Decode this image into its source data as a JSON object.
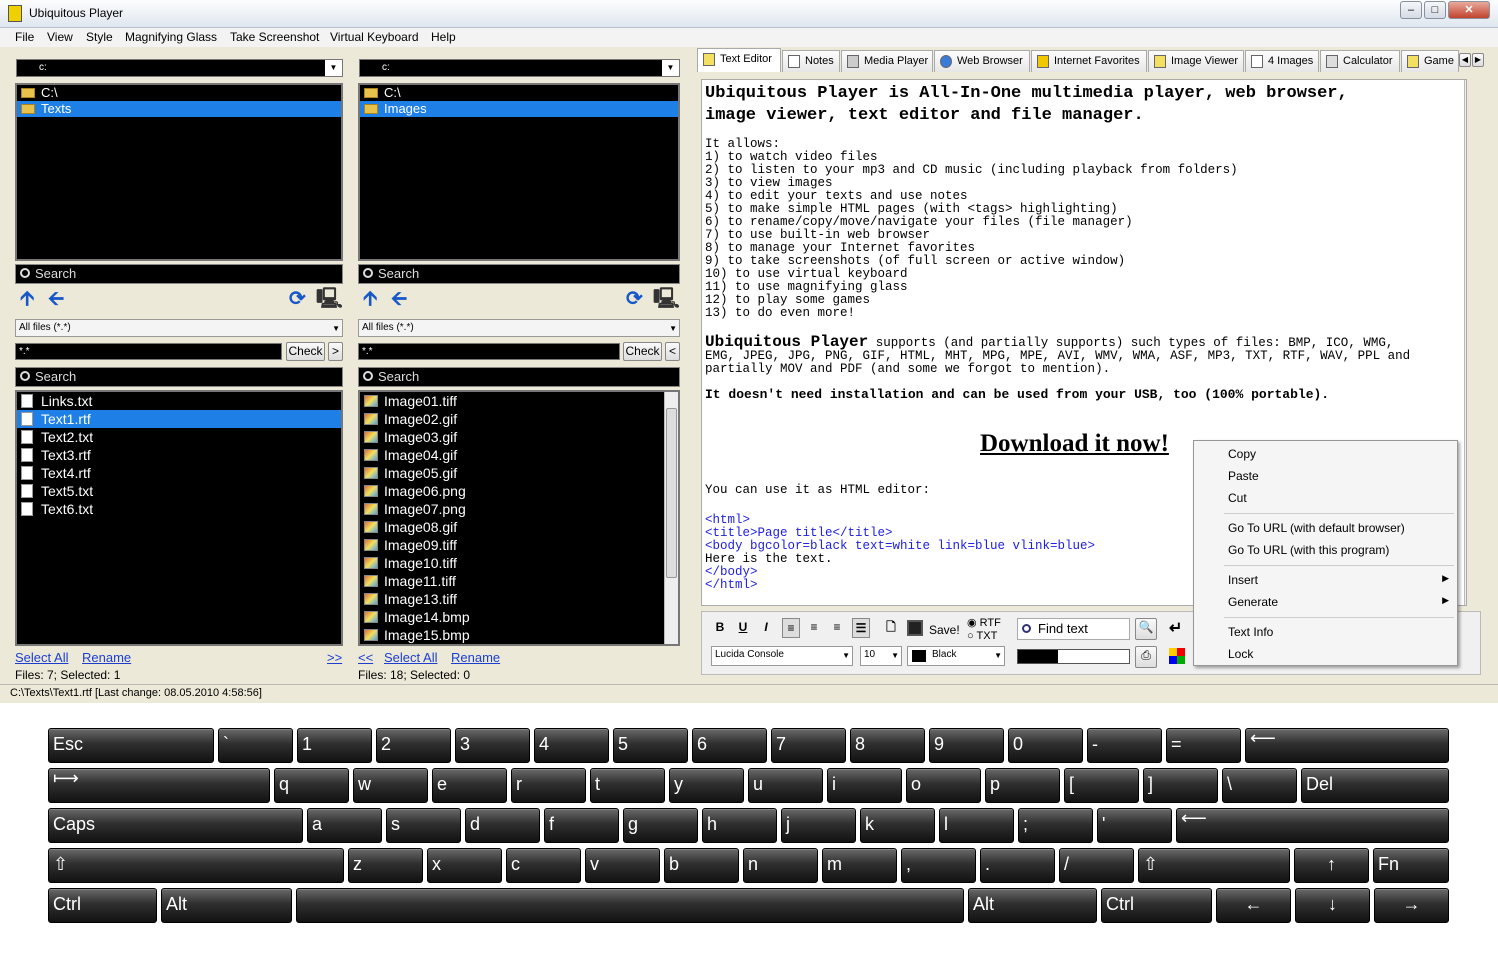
{
  "window": {
    "title": "Ubiquitous Player",
    "min": "–",
    "max": "□",
    "close": "✕"
  },
  "menu": [
    "File",
    "View",
    "Style",
    "Magnifying Glass",
    "Take Screenshot",
    "Virtual Keyboard",
    "Help"
  ],
  "left": {
    "drive": "c:",
    "tree": [
      "C:\\",
      "Texts"
    ],
    "search": "Search",
    "filter": "All files (*.*)",
    "mask": "*.*",
    "check": "Check",
    "nav_btn": ">",
    "search2": "Search",
    "files": [
      "Links.txt",
      "Text1.rtf",
      "Text2.txt",
      "Text3.rtf",
      "Text4.rtf",
      "Text5.txt",
      "Text6.txt"
    ],
    "select_all": "Select All",
    "rename": "Rename",
    "arrows": ">>",
    "status": "Files: 7; Selected: 1"
  },
  "right": {
    "drive": "c:",
    "tree": [
      "C:\\",
      "Images"
    ],
    "search": "Search",
    "filter": "All files (*.*)",
    "mask": "*.*",
    "check": "Check",
    "nav_btn": "<",
    "search2": "Search",
    "files": [
      "Image01.tiff",
      "Image02.gif",
      "Image03.gif",
      "Image04.gif",
      "Image05.gif",
      "Image06.png",
      "Image07.png",
      "Image08.gif",
      "Image09.tiff",
      "Image10.tiff",
      "Image11.tiff",
      "Image13.tiff",
      "Image14.bmp",
      "Image15.bmp"
    ],
    "select_all": "Select All",
    "rename": "Rename",
    "arrows": "<<",
    "status": "Files: 18; Selected: 0"
  },
  "tabs": [
    "Text Editor",
    "Notes",
    "Media Player",
    "Web Browser",
    "Internet Favorites",
    "Image Viewer",
    "4 Images",
    "Calculator",
    "Game"
  ],
  "editor": {
    "heading1": "Ubiquitous Player is All-In-One multimedia player, web browser,",
    "heading2": "image viewer, text editor and file manager.",
    "allows": "It allows:",
    "items": [
      "1) to watch video files",
      "2) to listen to your mp3 and CD music (including playback from folders)",
      "3) to view images",
      "4) to edit your texts and use notes",
      "5) to make simple HTML pages (with <tags> highlighting)",
      "6) to rename/copy/move/navigate your files (file manager)",
      "7) to use built-in web browser",
      "8) to manage your Internet favorites",
      "9) to take screenshots (of full screen or active window)",
      "10) to use virtual keyboard",
      "11) to use magnifying glass",
      "12) to play some games",
      "13) to do even more!"
    ],
    "supports_title": "Ubiquitous Player",
    "supports_text": " supports (and partially supports) such types of files: BMP, ICO, WMG,",
    "supports_2": "EMG, JPEG, JPG, PNG, GIF, HTML, MHT, MPG, MPE, AVI, WMV, WMA, ASF, MP3, TXT, RTF, WAV, PPL and",
    "supports_3": "partially MOV and PDF (and some we forgot to mention).",
    "portable": "It doesn't need installation and can be used from your USB, too (100% portable).",
    "download": "Download it now!",
    "html_intro": "You can use it as HTML editor:",
    "html_lines": [
      "<html>",
      "<title>Page title</title>",
      "<body bgcolor=black text=white link=blue vlink=blue>",
      "Here is the text.",
      "</body>",
      "</html>"
    ]
  },
  "toolbar": {
    "bold": "B",
    "underline": "U",
    "italic": "I",
    "save": "Save!",
    "rtf": "RTF",
    "txt": "TXT",
    "find": "Find text",
    "font": "Lucida Console",
    "size": "10",
    "color": "Black",
    "progress": "36%",
    "progress_value": 0.36
  },
  "context_menu": [
    "Copy",
    "Paste",
    "Cut",
    "Go To URL (with default browser)",
    "Go To URL (with this program)",
    "Insert",
    "Generate",
    "Text Info",
    "Lock"
  ],
  "status_path": "C:\\Texts\\Text1.rtf [Last change: 08.05.2010 4:58:56]",
  "keyboard": {
    "row1": [
      "Esc",
      "`",
      "1",
      "2",
      "3",
      "4",
      "5",
      "6",
      "7",
      "8",
      "9",
      "0",
      "-",
      "=",
      "⟵"
    ],
    "row2": [
      "⟼",
      "q",
      "w",
      "e",
      "r",
      "t",
      "y",
      "u",
      "i",
      "o",
      "p",
      "[",
      "]",
      "\\",
      "Del"
    ],
    "row3": [
      "Caps",
      "a",
      "s",
      "d",
      "f",
      "g",
      "h",
      "j",
      "k",
      "l",
      ";",
      "'",
      "⟵"
    ],
    "row4": [
      "⇧",
      "z",
      "x",
      "c",
      "v",
      "b",
      "n",
      "m",
      ",",
      ".",
      "/",
      "⇧",
      "↑",
      "Fn"
    ],
    "row5": [
      "Ctrl",
      "Alt",
      "",
      "Alt",
      "Ctrl",
      "←",
      "↓",
      "→"
    ]
  }
}
